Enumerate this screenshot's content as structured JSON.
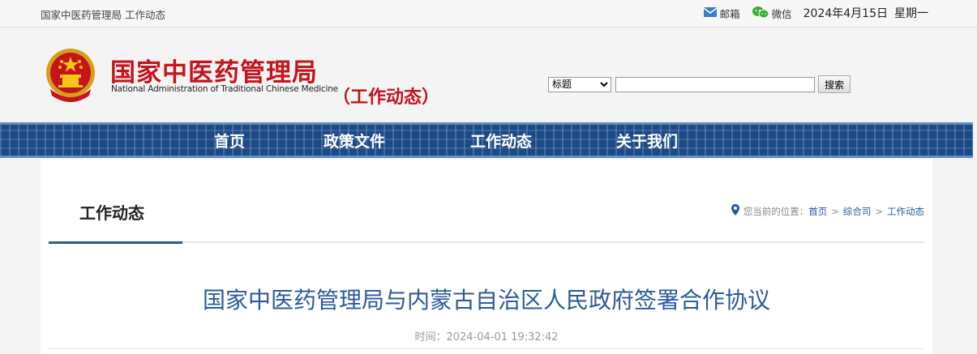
{
  "topbar": {
    "crumb": "国家中医药管理局 工作动态",
    "mail_label": "邮箱",
    "wechat_label": "微信",
    "date": "2024年4月15日",
    "weekday": "星期一"
  },
  "header": {
    "brand_cn": "国家中医药管理局",
    "brand_en": "National Administration of Traditional Chinese Medicine",
    "subtag": "（工作动态）"
  },
  "search": {
    "select_value": "标题",
    "input_value": "",
    "button_label": "搜索"
  },
  "nav": {
    "items": [
      {
        "label": "首页"
      },
      {
        "label": "政策文件"
      },
      {
        "label": "工作动态"
      },
      {
        "label": "关于我们"
      }
    ]
  },
  "section": {
    "title": "工作动态",
    "location_prefix": "您当前的位置：",
    "breadcrumb": [
      "首页",
      "综合司",
      "工作动态"
    ]
  },
  "article": {
    "title": "国家中医药管理局与内蒙古自治区人民政府签署合作协议",
    "time_label": "时间：",
    "time": "2024-04-01 19:32:42"
  },
  "colors": {
    "brand_red": "#c4141c",
    "nav_blue": "#1c4a86",
    "link_blue": "#2a5a9a"
  }
}
